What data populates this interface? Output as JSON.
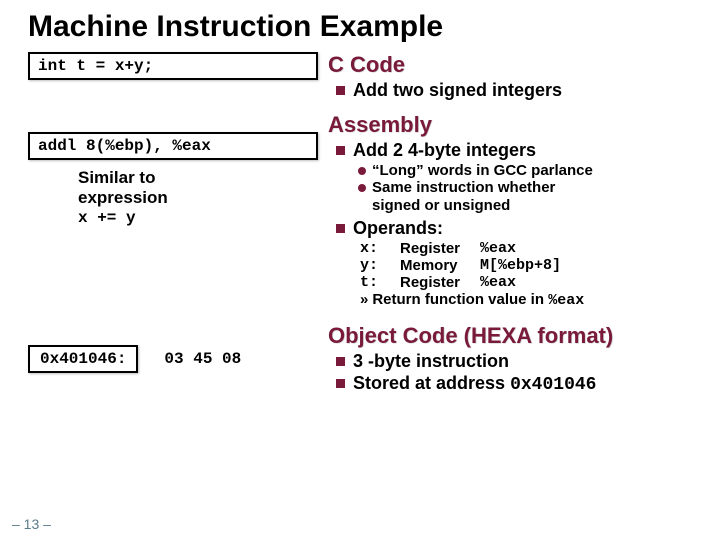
{
  "title": "Machine Instruction Example",
  "c_code_box": "int t = x+y;",
  "asm_box": "addl 8(%ebp), %eax",
  "note": {
    "line1": "Similar to",
    "line2": "expression",
    "line3": "x += y"
  },
  "sections": {
    "c": {
      "heading": "C Code",
      "bullet": "Add two signed integers"
    },
    "asm": {
      "heading": "Assembly",
      "bullet1": "Add 2 4-byte integers",
      "sub1": "“Long” words in GCC parlance",
      "sub2a": "Same instruction whether",
      "sub2b": "signed or unsigned",
      "bullet2": "Operands:",
      "operands": [
        {
          "name": "x:",
          "kind": "Register",
          "loc": "%eax"
        },
        {
          "name": "y:",
          "kind": "Memory",
          "loc": "M[%ebp+8]"
        },
        {
          "name": "t:",
          "kind": "Register",
          "loc": "%eax"
        }
      ],
      "return_prefix": "»",
      "return_text": "Return function value in ",
      "return_reg": "%eax"
    },
    "obj": {
      "heading": "Object Code (HEXA format)",
      "addr": "0x401046:",
      "bytes": "03 45 08",
      "bullet1": "3 -byte instruction",
      "bullet2_prefix": "Stored at address ",
      "bullet2_addr": "0x401046"
    }
  },
  "page_number": "– 13 –"
}
